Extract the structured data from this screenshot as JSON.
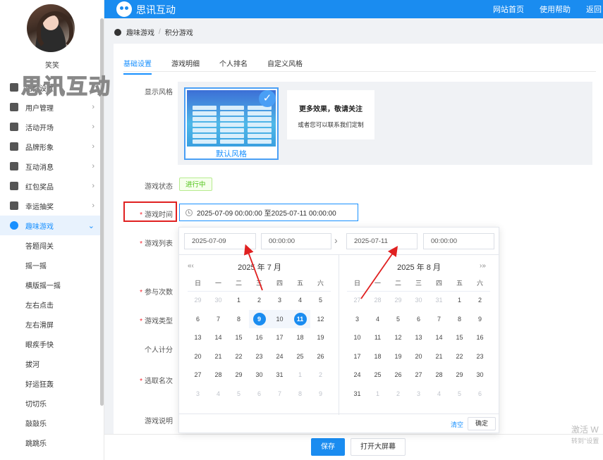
{
  "topbar": {
    "brand": "思讯互动",
    "links": [
      "网站首页",
      "使用帮助",
      "返回"
    ]
  },
  "sidebar": {
    "username": "笑笑",
    "watermark": "思讯互动",
    "items": [
      {
        "label": "活动设置",
        "icon": "gear-icon"
      },
      {
        "label": "用户管理",
        "icon": "user-icon"
      },
      {
        "label": "活动开场",
        "icon": "send-icon"
      },
      {
        "label": "品牌形象",
        "icon": "registered-icon"
      },
      {
        "label": "互动消息",
        "icon": "message-icon"
      },
      {
        "label": "红包奖品",
        "icon": "gift-icon"
      },
      {
        "label": "幸运抽奖",
        "icon": "lottery-icon"
      },
      {
        "label": "趣味游戏",
        "icon": "game-icon",
        "active": true
      }
    ],
    "subitems": [
      "答题闯关",
      "摇一摇",
      "横版摇一摇",
      "左右点击",
      "左右滑屏",
      "眼疾手快",
      "拔河",
      "好运狂轰",
      "切切乐",
      "敲敲乐",
      "跳跳乐"
    ]
  },
  "breadcrumb": {
    "root": "趣味游戏",
    "sep": "/",
    "current": "积分游戏"
  },
  "tabs": [
    "基础设置",
    "游戏明细",
    "个人排名",
    "自定义风格"
  ],
  "form": {
    "display_style_label": "显示风格",
    "style_name": "默认风格",
    "more_title": "更多效果，敬请关注",
    "more_sub": "或者您可以联系我们定制",
    "status_label": "游戏状态",
    "status_value": "进行中",
    "time_label": "游戏时间",
    "time_value": "2025-07-09 00:00:00 至2025-07-11 00:00:00",
    "list_label": "游戏列表",
    "count_label": "参与次数",
    "type_label": "游戏类型",
    "personal_label": "个人计分",
    "pick_label": "选取名次",
    "desc_label": "游戏说明"
  },
  "picker": {
    "start_date": "2025-07-09",
    "start_time": "00:00:00",
    "end_date": "2025-07-11",
    "end_time": "00:00:00",
    "left_title": "2025 年 7 月",
    "right_title": "2025 年 8 月",
    "weekdays": [
      "日",
      "一",
      "二",
      "三",
      "四",
      "五",
      "六"
    ],
    "left_days": [
      [
        "29",
        "30",
        "1",
        "2",
        "3",
        "4",
        "5"
      ],
      [
        "6",
        "7",
        "8",
        "9",
        "10",
        "11",
        "12"
      ],
      [
        "13",
        "14",
        "15",
        "16",
        "17",
        "18",
        "19"
      ],
      [
        "20",
        "21",
        "22",
        "23",
        "24",
        "25",
        "26"
      ],
      [
        "27",
        "28",
        "29",
        "30",
        "31",
        "1",
        "2"
      ],
      [
        "3",
        "4",
        "5",
        "6",
        "7",
        "8",
        "9"
      ]
    ],
    "right_days": [
      [
        "27",
        "28",
        "29",
        "30",
        "31",
        "1",
        "2"
      ],
      [
        "3",
        "4",
        "5",
        "6",
        "7",
        "8",
        "9"
      ],
      [
        "10",
        "11",
        "12",
        "13",
        "14",
        "15",
        "16"
      ],
      [
        "17",
        "18",
        "19",
        "20",
        "21",
        "22",
        "23"
      ],
      [
        "24",
        "25",
        "26",
        "27",
        "28",
        "29",
        "30"
      ],
      [
        "31",
        "1",
        "2",
        "3",
        "4",
        "5",
        "6"
      ]
    ],
    "left_prev": "«‹",
    "right_next": "›»",
    "clear": "清空",
    "ok": "确定"
  },
  "bottom": {
    "save": "保存",
    "big_screen": "打开大屏幕"
  },
  "activate": {
    "title": "激活 W",
    "sub": "转到\"设置"
  },
  "colors": {
    "primary": "#1a8cf0",
    "annotation": "#e02020",
    "success": "#52c41a"
  }
}
